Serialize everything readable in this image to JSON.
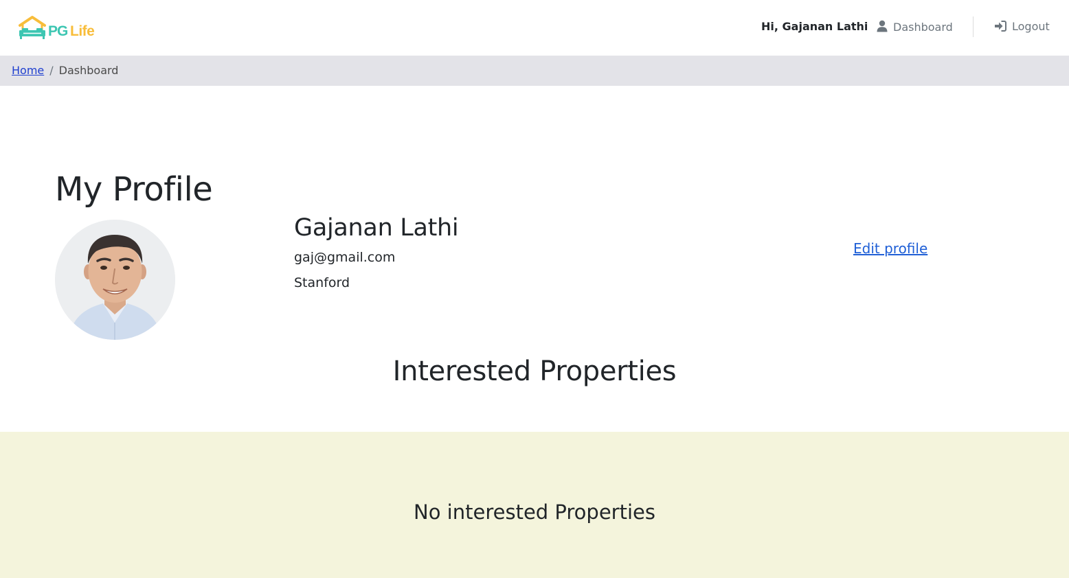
{
  "header": {
    "logo": {
      "pg": "PG",
      "life": "Life"
    },
    "greeting": "Hi, Gajanan Lathi",
    "dashboard_label": "Dashboard",
    "logout_label": "Logout"
  },
  "breadcrumb": {
    "home": "Home",
    "separator": "/",
    "current": "Dashboard"
  },
  "profile": {
    "title": "My Profile",
    "name": "Gajanan Lathi",
    "email": "gaj@gmail.com",
    "college": "Stanford",
    "edit_label": "Edit profile"
  },
  "interested": {
    "title": "Interested Properties",
    "empty_message": "No interested Properties"
  },
  "colors": {
    "brand_teal": "#3dc6b2",
    "brand_yellow": "#f8bd3a",
    "breadcrumb_bg": "#e3e3e8",
    "panel_bg": "#f4f4dc",
    "link": "#1f5fd6"
  },
  "icons": {
    "logo": "house-bed-logo",
    "dashboard": "user-icon",
    "logout": "sign-in-icon"
  }
}
